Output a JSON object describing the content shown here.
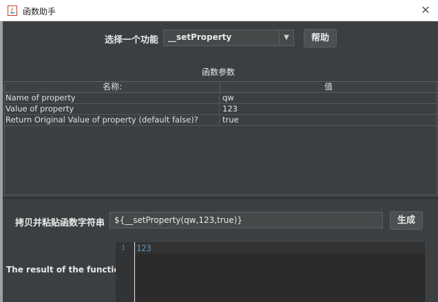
{
  "window": {
    "title": "函数助手",
    "close_label": "✕"
  },
  "selector": {
    "label": "选择一个功能",
    "selected": "__setProperty",
    "help_button": "帮助"
  },
  "params": {
    "heading": "函数参数",
    "columns": [
      "名称:",
      "值"
    ],
    "rows": [
      {
        "name": "Name of property",
        "value": "qw"
      },
      {
        "name": "Value of property",
        "value": "123"
      },
      {
        "name": "Return Original Value of property (default false)?",
        "value": "true"
      }
    ]
  },
  "copy": {
    "label": "拷贝并粘贴函数字符串",
    "value": "${__setProperty(qw,123,true)}",
    "generate_button": "生成"
  },
  "result": {
    "label": "The result of the function is",
    "line_number": "1",
    "text": "123"
  }
}
